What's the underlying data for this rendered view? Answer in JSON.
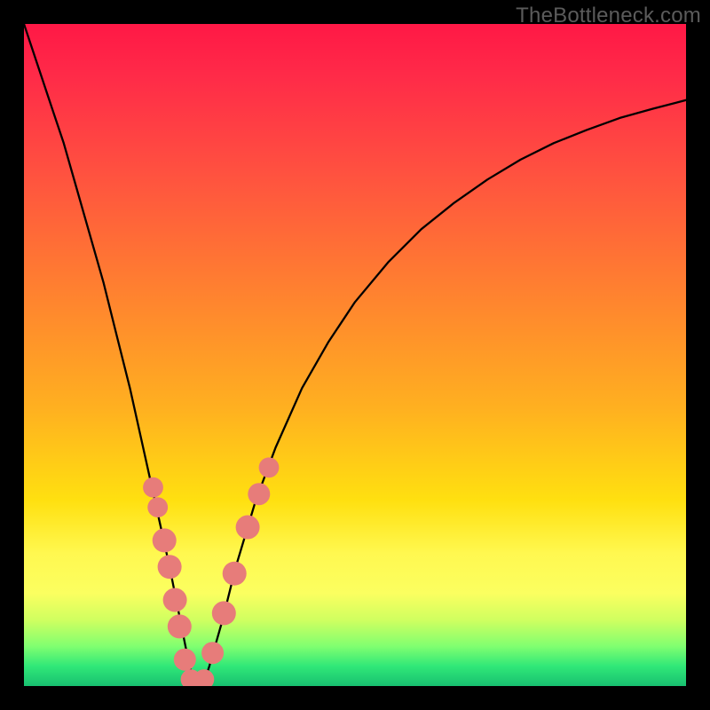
{
  "watermark": {
    "text": "TheBottleneck.com"
  },
  "chart_data": {
    "type": "line",
    "title": "",
    "xlabel": "",
    "ylabel": "",
    "xlim": [
      0,
      100
    ],
    "ylim": [
      0,
      100
    ],
    "series": [
      {
        "name": "bottleneck-curve",
        "x": [
          0,
          2,
          4,
          6,
          8,
          10,
          12,
          14,
          16,
          18,
          20,
          22,
          24,
          25,
          26,
          27,
          28,
          30,
          32,
          35,
          38,
          42,
          46,
          50,
          55,
          60,
          65,
          70,
          75,
          80,
          85,
          90,
          95,
          100
        ],
        "y": [
          100,
          94,
          88,
          82,
          75,
          68,
          61,
          53,
          45,
          36,
          27,
          18,
          8,
          3,
          0,
          0,
          3,
          10,
          18,
          28,
          36,
          45,
          52,
          58,
          64,
          69,
          73,
          76.5,
          79.5,
          82,
          84,
          85.8,
          87.2,
          88.5
        ]
      }
    ],
    "markers": {
      "name": "highlight-points",
      "color": "#e77c7a",
      "points": [
        {
          "x": 19.5,
          "y": 30,
          "r": 2.2
        },
        {
          "x": 20.2,
          "y": 27,
          "r": 2.2
        },
        {
          "x": 21.2,
          "y": 22,
          "r": 2.6
        },
        {
          "x": 22.0,
          "y": 18,
          "r": 2.6
        },
        {
          "x": 22.8,
          "y": 13,
          "r": 2.6
        },
        {
          "x": 23.5,
          "y": 9,
          "r": 2.6
        },
        {
          "x": 24.3,
          "y": 4,
          "r": 2.4
        },
        {
          "x": 25.2,
          "y": 1,
          "r": 2.2
        },
        {
          "x": 26.2,
          "y": 0,
          "r": 2.2
        },
        {
          "x": 27.2,
          "y": 1,
          "r": 2.2
        },
        {
          "x": 28.5,
          "y": 5,
          "r": 2.4
        },
        {
          "x": 30.2,
          "y": 11,
          "r": 2.6
        },
        {
          "x": 31.8,
          "y": 17,
          "r": 2.6
        },
        {
          "x": 33.8,
          "y": 24,
          "r": 2.6
        },
        {
          "x": 35.5,
          "y": 29,
          "r": 2.4
        },
        {
          "x": 37.0,
          "y": 33,
          "r": 2.2
        }
      ]
    },
    "gradient_stops": [
      {
        "pos": 0.0,
        "color": "#ff1846"
      },
      {
        "pos": 0.4,
        "color": "#ff8030"
      },
      {
        "pos": 0.72,
        "color": "#ffe010"
      },
      {
        "pos": 0.9,
        "color": "#d0ff60"
      },
      {
        "pos": 1.0,
        "color": "#18c070"
      }
    ]
  }
}
